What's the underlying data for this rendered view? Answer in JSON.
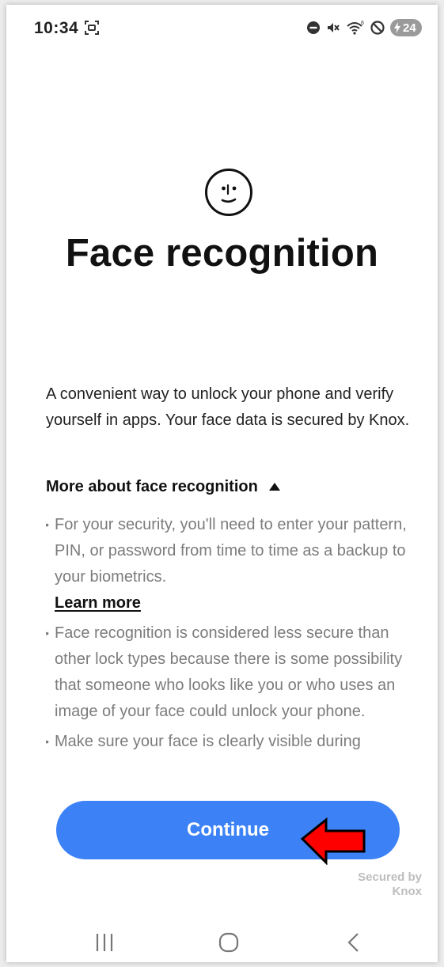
{
  "status_bar": {
    "time": "10:34",
    "battery_level": "24",
    "icons": [
      "screen-capture-icon",
      "do-not-disturb-icon",
      "vibrate-mute-icon",
      "wifi-6-icon",
      "blocked-icon",
      "battery-charging-icon"
    ]
  },
  "header": {
    "icon": "smiley-face-icon",
    "title": "Face recognition"
  },
  "intro_text": "A convenient way to unlock your phone and verify yourself in apps. Your face data is secured by Knox.",
  "more_section": {
    "label": "More about face recognition",
    "expanded": true,
    "bullets": [
      "For your security, you'll need to enter your pattern, PIN, or password from time to time as a backup to your biometrics.",
      "Face recognition is considered less secure than other lock types because there is some possibility that someone who looks like you or who uses an image of your face could unlock your phone.",
      "Make sure your face is clearly visible during"
    ],
    "learn_more": "Learn more"
  },
  "continue_button": {
    "label": "Continue",
    "color": "#3c82f6"
  },
  "annotation": {
    "color": "#ff0000"
  },
  "footer": {
    "secured_line1": "Secured by",
    "secured_line2": "Knox"
  },
  "nav_bar": {
    "buttons": [
      "recent-apps-icon",
      "home-icon",
      "back-icon"
    ]
  }
}
